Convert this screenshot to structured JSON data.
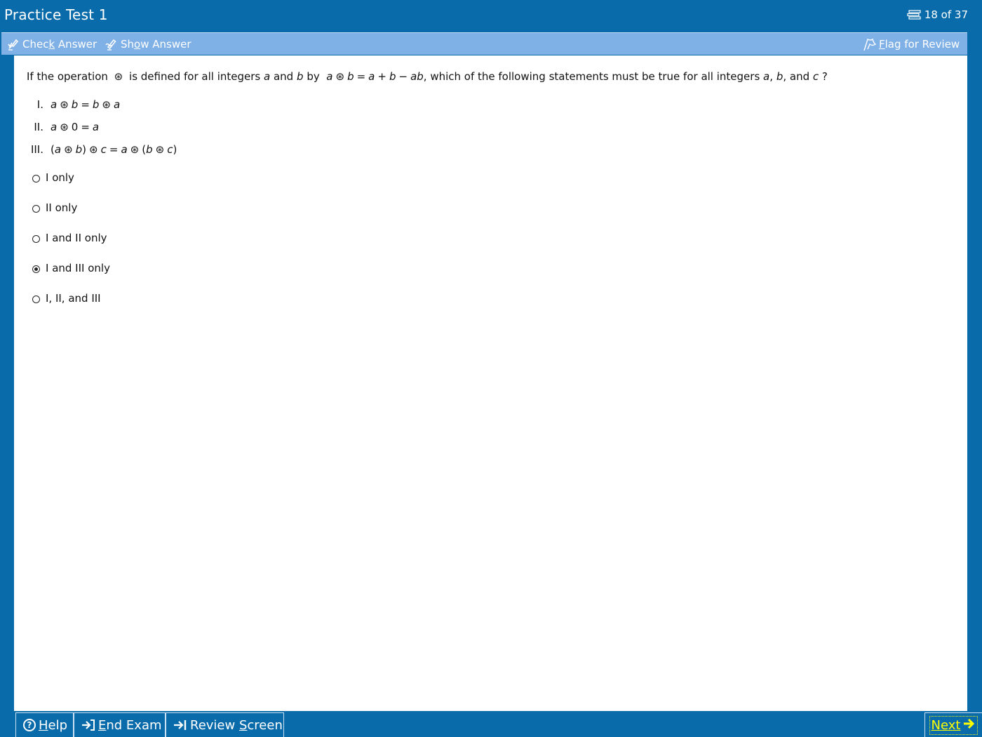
{
  "window": {
    "title": "Practice Test 1",
    "counter": "18 of 37",
    "counter_icon": "list-icon"
  },
  "toolbar": {
    "check_answer": {
      "prefix": "Chec",
      "underline": "k",
      "suffix": " Answer",
      "icon": "check-pen-icon"
    },
    "show_answer": {
      "prefix": "Sh",
      "underline": "o",
      "suffix": "w Answer",
      "icon": "show-pen-icon"
    },
    "flag_review": {
      "prefix": "",
      "underline": "F",
      "suffix": "lag for Review",
      "icon": "flag-icon"
    }
  },
  "question": {
    "stem": {
      "p1": "If the operation",
      "op_symbol": "⊛",
      "p2": "is defined for all integers",
      "var_a": "a",
      "p3": "and",
      "var_b": "b",
      "p4": "by",
      "def_a": "a",
      "def_op": "⊛",
      "def_b": "b",
      "def_eq": "=",
      "def_r1": "a",
      "def_plus": "+",
      "def_r2": "b",
      "def_minus": "−",
      "def_r3": "ab",
      "p5": ", which of the following statements must be true for all integers",
      "end_a": "a",
      "comma1": ",",
      "end_b": "b",
      "p6": ", and",
      "end_c": "c",
      "qmark": "?"
    },
    "statements": [
      {
        "num": "I.",
        "parts": [
          "a",
          "⊛",
          "b",
          "=",
          "b",
          "⊛",
          "a"
        ]
      },
      {
        "num": "II.",
        "parts": [
          "a",
          "⊛",
          "0",
          "=",
          "a"
        ]
      },
      {
        "num": "III.",
        "parts": [
          "(",
          "a",
          "⊛",
          "b",
          ")",
          "⊛",
          "c",
          "=",
          "a",
          "⊛",
          "(",
          "b",
          "⊛",
          "c",
          ")"
        ]
      }
    ],
    "choices": [
      {
        "label": "I only",
        "selected": false
      },
      {
        "label": "II only",
        "selected": false
      },
      {
        "label": "I and II only",
        "selected": false
      },
      {
        "label": "I and III only",
        "selected": true
      },
      {
        "label": "I, II, and III",
        "selected": false
      }
    ]
  },
  "bottom": {
    "help": {
      "prefix": "",
      "underline": "H",
      "suffix": "elp",
      "icon": "help-icon"
    },
    "end_exam": {
      "prefix": "",
      "underline": "E",
      "suffix": "nd Exam",
      "icon": "end-exam-icon"
    },
    "review": {
      "prefix": "Review ",
      "underline": "S",
      "suffix": "creen",
      "icon": "review-icon"
    },
    "next": {
      "label": "Next",
      "icon": "next-arrow-icon"
    }
  },
  "colors": {
    "frame": "#0a6bab",
    "toolbar": "#7fb0e6",
    "next_accent": "#ffff00"
  }
}
